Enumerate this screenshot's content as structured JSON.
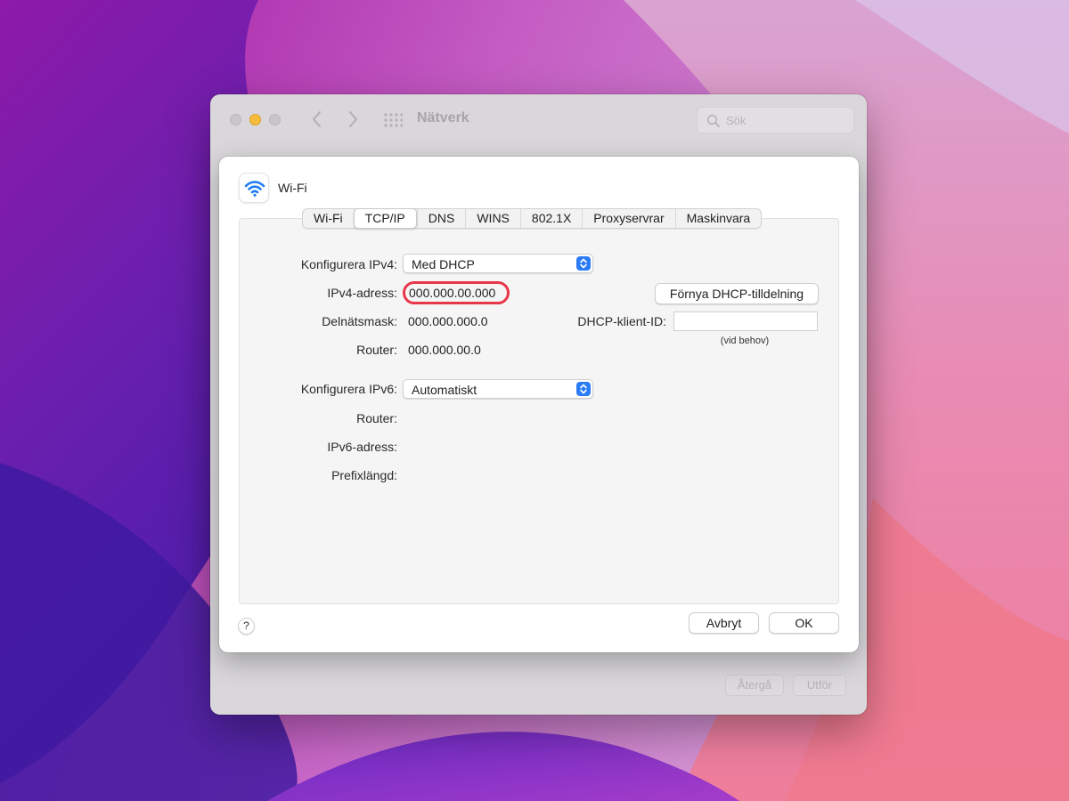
{
  "window": {
    "title": "Nätverk",
    "search_placeholder": "Sök",
    "revert_label": "Återgå",
    "apply_label": "Utför"
  },
  "sheet": {
    "interface_name": "Wi-Fi",
    "tabs": [
      {
        "label": "Wi-Fi",
        "active": false
      },
      {
        "label": "TCP/IP",
        "active": true
      },
      {
        "label": "DNS",
        "active": false
      },
      {
        "label": "WINS",
        "active": false
      },
      {
        "label": "802.1X",
        "active": false
      },
      {
        "label": "Proxyservrar",
        "active": false
      },
      {
        "label": "Maskinvara",
        "active": false
      }
    ],
    "ipv4": {
      "configure_label": "Konfigurera IPv4:",
      "configure_value": "Med DHCP",
      "address_label": "IPv4-adress:",
      "address_value": "000.000.00.000",
      "subnet_label": "Delnätsmask:",
      "subnet_value": "000.000.000.0",
      "router_label": "Router:",
      "router_value": "000.000.00.0",
      "renew_button": "Förnya DHCP-tilldelning",
      "dhcp_client_id_label": "DHCP-klient-ID:",
      "dhcp_client_id_value": "",
      "dhcp_client_id_hint": "(vid behov)"
    },
    "ipv6": {
      "configure_label": "Konfigurera IPv6:",
      "configure_value": "Automatiskt",
      "router_label": "Router:",
      "address_label": "IPv6-adress:",
      "prefix_label": "Prefixlängd:"
    },
    "help_label": "?",
    "cancel_button": "Avbryt",
    "ok_button": "OK"
  },
  "colors": {
    "accent": "#2b7cf6",
    "highlight_ring": "#e8374a",
    "minimize": "#f6bc3b"
  }
}
